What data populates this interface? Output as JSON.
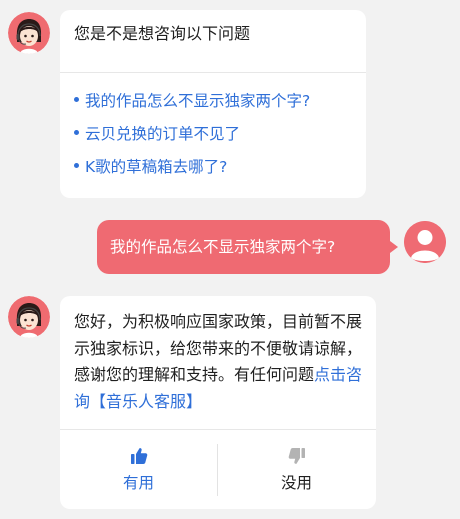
{
  "colors": {
    "link": "#2f6fd8",
    "user_bubble": "#ef6a72",
    "background": "#f2f2f2",
    "card": "#ffffff"
  },
  "messages": {
    "bot_suggestions": {
      "avatar_icon": "customer-service-girl-icon",
      "title": "您是不是想咨询以下问题",
      "questions": [
        "我的作品怎么不显示独家两个字?",
        "云贝兑换的订单不见了",
        "K歌的草稿箱去哪了?"
      ]
    },
    "user": {
      "avatar_icon": "user-silhouette-icon",
      "text": "我的作品怎么不显示独家两个字?"
    },
    "bot_answer": {
      "avatar_icon": "customer-service-girl-icon",
      "text": "您好，为积极响应国家政策，目前暂不展示独家标识，给您带来的不便敬请谅解，感谢您的理解和支持。有任何问题",
      "link_text": "点击咨询【音乐人客服】",
      "feedback": {
        "useful_label": "有用",
        "useful_icon": "thumbs-up-icon",
        "useless_label": "没用",
        "useless_icon": "thumbs-down-icon"
      }
    }
  }
}
